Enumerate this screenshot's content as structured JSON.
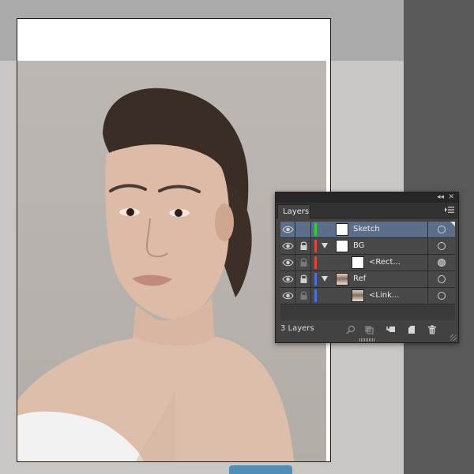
{
  "panel": {
    "title": "Layers",
    "collapse_glyph": "◂◂",
    "close_glyph": "✕",
    "layer_count": "3 Layers"
  },
  "layers": [
    {
      "name": "Sketch",
      "indent": 0,
      "color": "#2fd13c",
      "selected": true,
      "has_toggle": false,
      "thumb": "white",
      "locked": false,
      "target": "empty"
    },
    {
      "name": "BG",
      "indent": 0,
      "color": "#e0423c",
      "selected": false,
      "has_toggle": true,
      "thumb": "white",
      "locked": true,
      "target": "empty"
    },
    {
      "name": "<Rect...",
      "indent": 1,
      "color": "#e0423c",
      "selected": false,
      "has_toggle": false,
      "thumb": "white",
      "locked": true,
      "target": "filled"
    },
    {
      "name": "Ref",
      "indent": 0,
      "color": "#4a6fe0",
      "selected": false,
      "has_toggle": true,
      "thumb": "photo",
      "locked": true,
      "target": "empty"
    },
    {
      "name": "<Link...",
      "indent": 1,
      "color": "#4a6fe0",
      "selected": false,
      "has_toggle": false,
      "thumb": "photo",
      "locked": true,
      "target": "empty"
    }
  ],
  "footer_icons": [
    "locate-object-icon",
    "make-clipping-mask-icon",
    "create-sublayer-icon",
    "create-new-layer-icon",
    "delete-layer-icon"
  ],
  "colors": {
    "pasteboard": "#ababab",
    "pasteboard_dark": "#595959",
    "panel_bg": "#424242",
    "selected_row": "#5c6e8a"
  }
}
